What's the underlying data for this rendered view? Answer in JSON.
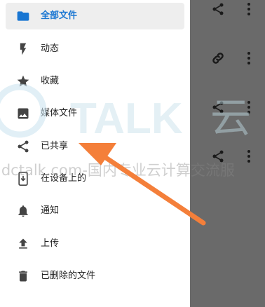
{
  "drawer": {
    "items": [
      {
        "label": "全部文件",
        "icon": "folder-icon",
        "active": true
      },
      {
        "label": "动态",
        "icon": "bolt-icon"
      },
      {
        "label": "收藏",
        "icon": "star-icon"
      },
      {
        "label": "媒体文件",
        "icon": "image-icon"
      },
      {
        "label": "已共享",
        "icon": "share-icon"
      },
      {
        "label": "在设备上的",
        "icon": "phone-download-icon"
      },
      {
        "label": "通知",
        "icon": "bell-icon"
      },
      {
        "label": "上传",
        "icon": "upload-icon"
      },
      {
        "label": "已删除的文件",
        "icon": "trash-icon"
      }
    ]
  },
  "watermark": {
    "brand": "TALK",
    "cloud": "云",
    "text": "idctalk.com-国内专业云计算交流服"
  },
  "colors": {
    "accent": "#1976d2",
    "arrow": "#f47f3a",
    "overlay": "#6a6a6a"
  }
}
